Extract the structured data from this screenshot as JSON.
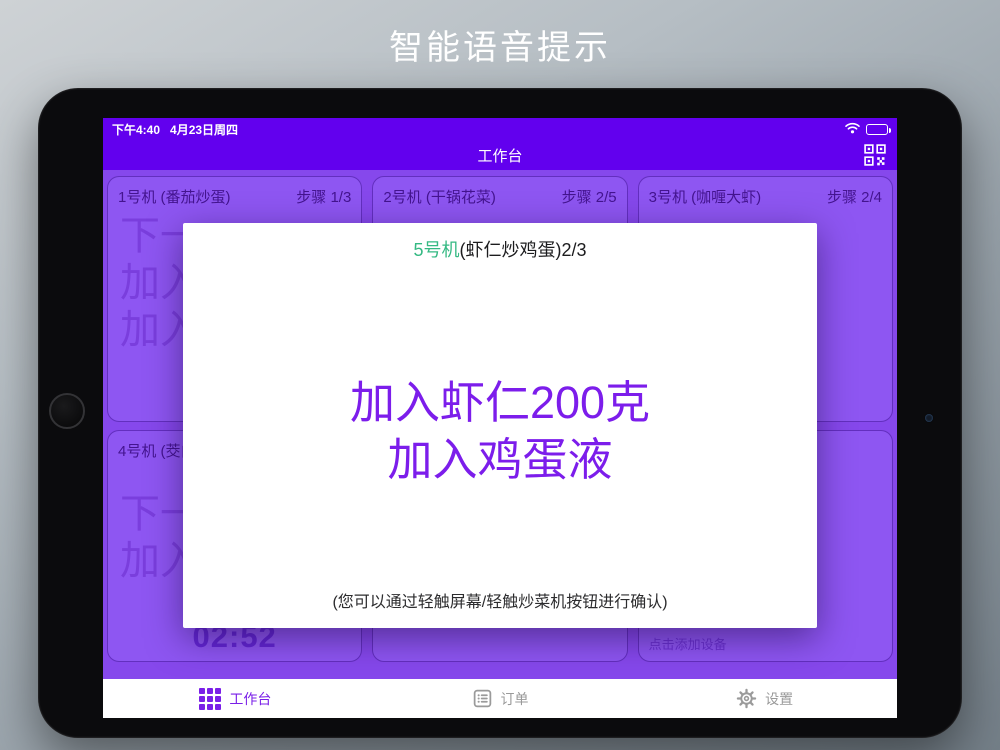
{
  "page": {
    "title": "智能语音提示"
  },
  "status_bar": {
    "time": "下午4:40",
    "date": "4月23日周四"
  },
  "nav": {
    "title": "工作台"
  },
  "machines": [
    {
      "label": "1号机 (番茄炒蛋)",
      "step": "步骤 1/3",
      "lines": [
        "下一",
        "加入",
        "加入"
      ]
    },
    {
      "label": "2号机 (干锅花菜)",
      "step": "步骤 2/5",
      "lines": []
    },
    {
      "label": "3号机 (咖喱大虾)",
      "step": "步骤 2/4",
      "lines": []
    },
    {
      "label": "4号机 (茭白",
      "step": "",
      "lines": [
        "下一",
        "加入"
      ],
      "timer": "02:52"
    }
  ],
  "add_device": {
    "label": "点击添加设备"
  },
  "modal": {
    "machine": "5号机",
    "dish_step": "(虾仁炒鸡蛋)2/3",
    "lines": [
      "加入虾仁200克",
      "加入鸡蛋液"
    ],
    "note": "(您可以通过轻触屏幕/轻触炒菜机按钮进行确认)"
  },
  "tab_bar": {
    "workbench": "工作台",
    "orders": "订单",
    "settings": "设置"
  },
  "icons": {
    "qr_scan": "qr-scan-icon",
    "wifi": "wifi-icon",
    "battery": "battery-icon",
    "workbench": "grid-icon",
    "orders": "order-list-icon",
    "settings": "gear-icon"
  },
  "colors": {
    "app_bar": "#6200ee",
    "main_bg": "#8648ec",
    "card_bg": "#8e56f2",
    "card_text": "#44148f",
    "modal_accent": "#7c1deb",
    "machine_green": "#35b983",
    "tab_active": "#7a1fe8",
    "tab_inactive": "#9a9a9a",
    "timer": "#6426d6"
  }
}
